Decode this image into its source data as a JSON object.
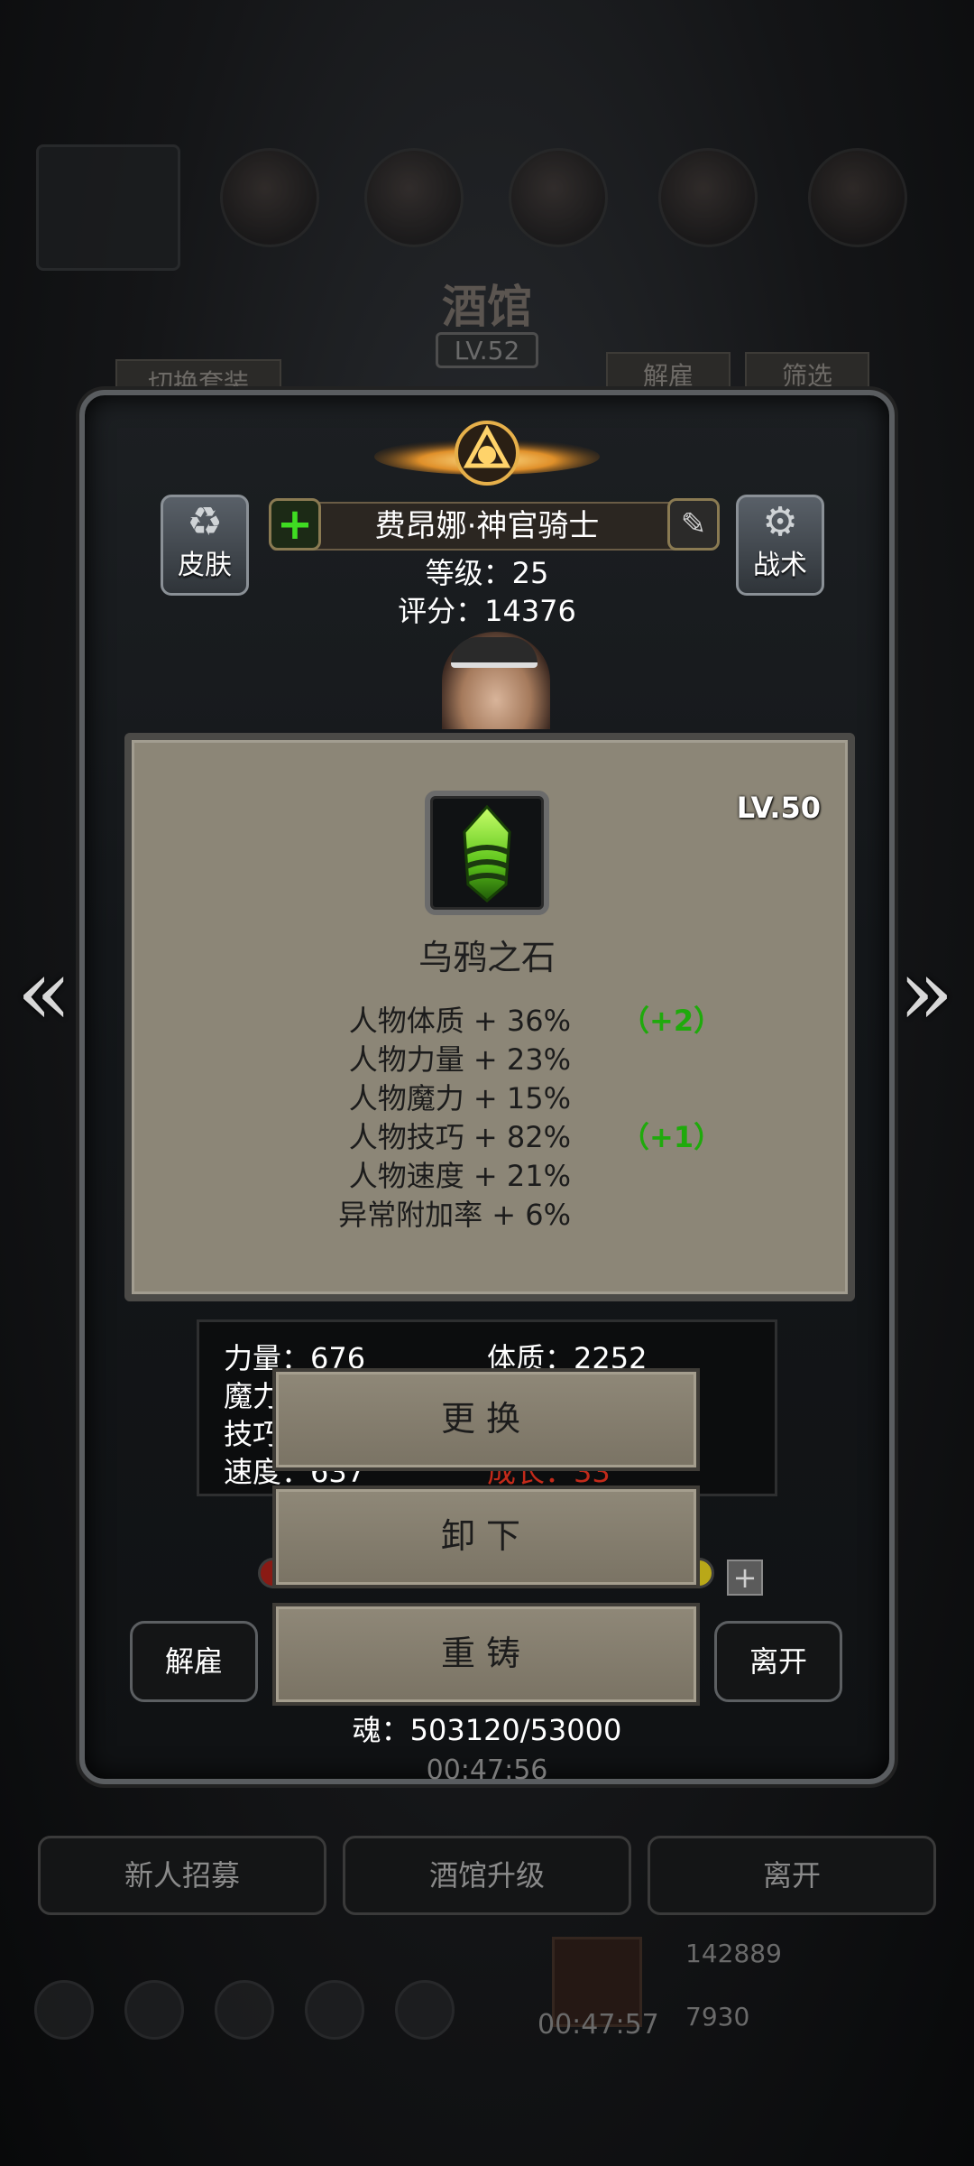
{
  "background": {
    "tavern_title": "酒馆",
    "tavern_level": "LV.52",
    "switch_outfit_label": "切换套装",
    "dismiss_label": "解雇",
    "filter_label": "筛选",
    "bottom_buttons": [
      "新人招募",
      "酒馆升级",
      "离开"
    ],
    "timer": "00:47:57",
    "coins": "142889",
    "gems": "7930"
  },
  "hero": {
    "skin_label": "皮肤",
    "tactics_label": "战术",
    "name": "费昂娜·神官骑士",
    "level_line": "等级：25",
    "score_line": "评分：14376"
  },
  "item": {
    "level": "LV.50",
    "name": "乌鸦之石",
    "stats": [
      {
        "text": "人物体质 + 36%",
        "bonus": "（+2）"
      },
      {
        "text": "人物力量 + 23%",
        "bonus": ""
      },
      {
        "text": "人物魔力 + 15%",
        "bonus": ""
      },
      {
        "text": "人物技巧 + 82%",
        "bonus": "（+1）"
      },
      {
        "text": "人物速度 + 21%",
        "bonus": ""
      },
      {
        "text": "异常附加率 + 6%",
        "bonus": ""
      }
    ]
  },
  "attributes": {
    "strength": "力量：676",
    "constitution": "体质：2252",
    "magic_partial": "魔力",
    "skill_partial": "技巧",
    "speed_partial": "速度：637",
    "growth_partial": "成长：33"
  },
  "actions": {
    "replace": "更换",
    "unequip": "卸下",
    "reforge": "重铸"
  },
  "footer": {
    "dismiss": "解雇",
    "leave": "离开",
    "soul": "魂：503120/53000",
    "timer": "00:47:56"
  },
  "colors": {
    "bonus_green": "#1faa0c",
    "panel_parchment": "#8c8677",
    "item_gem": "#6ed21e"
  },
  "icons": {
    "skin": "shirt-refresh-icon",
    "tactics": "gear-icon",
    "add": "plus-icon",
    "edit": "pencil-icon",
    "prev": "double-chevron-left-icon",
    "next": "double-chevron-right-icon"
  }
}
